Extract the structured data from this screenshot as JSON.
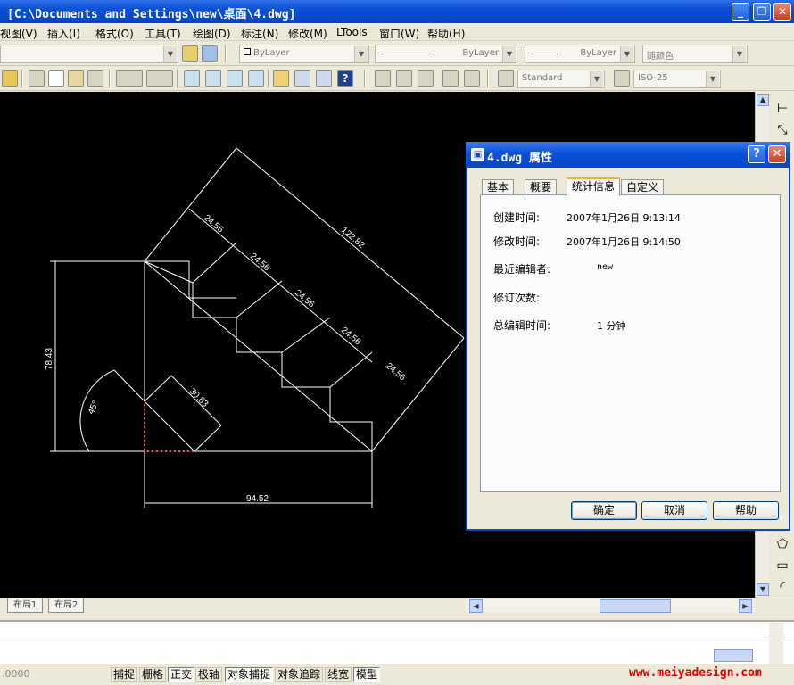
{
  "window": {
    "title": "[C:\\Documents and Settings\\new\\桌面\\4.dwg]"
  },
  "menu": [
    "视图(V)",
    "插入(I)",
    "格式(O)",
    "工具(T)",
    "绘图(D)",
    "标注(N)",
    "修改(M)",
    "LTools",
    "窗口(W)",
    "帮助(H)"
  ],
  "properties_toolbar": {
    "layer": "ByLayer",
    "linetype": "ByLayer",
    "lineweight": "ByLayer",
    "color": "随颜色"
  },
  "styles_toolbar": {
    "text_style": "Standard",
    "dim_style": "ISO-25"
  },
  "drawing": {
    "dims": [
      "24.56",
      "24.56",
      "24.56",
      "24.56",
      "24.56",
      "122.82",
      "78.43",
      "94.52",
      "30.83",
      "45°"
    ]
  },
  "layout_tabs": [
    "布局1",
    "布局2"
  ],
  "status": {
    "coords": ".0000",
    "buttons": [
      {
        "label": "捕捉",
        "on": false
      },
      {
        "label": "栅格",
        "on": false
      },
      {
        "label": "正交",
        "on": true
      },
      {
        "label": "极轴",
        "on": false
      },
      {
        "label": "对象捕捉",
        "on": true
      },
      {
        "label": "对象追踪",
        "on": false
      },
      {
        "label": "线宽",
        "on": false
      },
      {
        "label": "模型",
        "on": true
      }
    ]
  },
  "watermark": "www.meiyadesign.com",
  "dialog": {
    "title": "4.dwg 属性",
    "tabs": [
      "基本",
      "概要",
      "统计信息",
      "自定义"
    ],
    "active_tab": "统计信息",
    "rows": [
      {
        "label": "创建时间:",
        "value": "2007年1月26日  9:13:14"
      },
      {
        "label": "修改时间:",
        "value": "2007年1月26日  9:14:50"
      },
      {
        "label": "最近编辑者:",
        "value": "new"
      },
      {
        "label": "修订次数:",
        "value": ""
      },
      {
        "label": "总编辑时间:",
        "value": "1 分钟"
      }
    ],
    "buttons": {
      "ok": "确定",
      "cancel": "取消",
      "help": "帮助"
    }
  }
}
